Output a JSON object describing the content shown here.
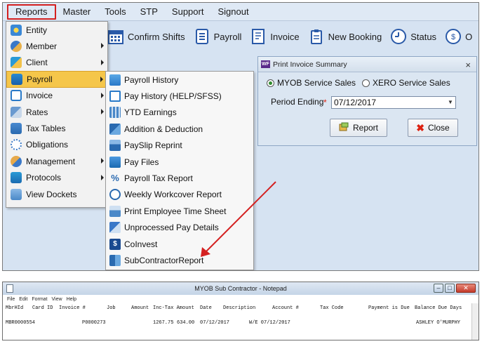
{
  "menubar": {
    "items": [
      "Reports",
      "Master",
      "Tools",
      "STP",
      "Support",
      "Signout"
    ]
  },
  "toolbar": {
    "items": [
      {
        "label": "Confirm Shifts",
        "icon": "calendar-icon"
      },
      {
        "label": "Payroll",
        "icon": "payroll-document-icon"
      },
      {
        "label": "Invoice",
        "icon": "invoice-document-icon"
      },
      {
        "label": "New Booking",
        "icon": "clipboard-icon"
      },
      {
        "label": "Status",
        "icon": "clock-icon"
      },
      {
        "label": "O",
        "icon": "dollar-clock-icon"
      }
    ]
  },
  "reports_menu": {
    "items": [
      {
        "label": "Entity",
        "icon": "entity-icon",
        "submenu": false
      },
      {
        "label": "Member",
        "icon": "member-icon",
        "submenu": true
      },
      {
        "label": "Client",
        "icon": "client-icon",
        "submenu": true
      },
      {
        "label": "Payroll",
        "icon": "payroll-folder-icon",
        "submenu": true
      },
      {
        "label": "Invoice",
        "icon": "invoice-icon",
        "submenu": true
      },
      {
        "label": "Rates",
        "icon": "rates-icon",
        "submenu": true
      },
      {
        "label": "Tax Tables",
        "icon": "tax-tables-icon",
        "submenu": false
      },
      {
        "label": "Obligations",
        "icon": "obligations-icon",
        "submenu": false
      },
      {
        "label": "Management",
        "icon": "management-icon",
        "submenu": true
      },
      {
        "label": "Protocols",
        "icon": "protocols-icon",
        "submenu": true
      },
      {
        "label": "View Dockets",
        "icon": "dockets-icon",
        "submenu": false
      }
    ]
  },
  "payroll_submenu": {
    "items": [
      "Payroll History",
      "Pay History (HELP/SFSS)",
      "YTD Earnings",
      "Addition & Deduction",
      "PaySlip Reprint",
      "Pay Files",
      "Payroll Tax Report",
      "Weekly Workcover Report",
      "Print Employee Time Sheet",
      "Unprocessed Pay Details",
      "CoInvest",
      "SubContractorReport"
    ]
  },
  "dialog": {
    "title": "Print Invoice Summary",
    "logo_text": "WF",
    "close_glyph": "×",
    "radio_myob": "MYOB Service Sales",
    "radio_xero": "XERO Service Sales",
    "selected": "MYOB Service Sales",
    "period_label": "Period Ending",
    "required_mark": "*",
    "period_value": "07/12/2017",
    "report_button": "Report",
    "close_button": "Close"
  },
  "notepad": {
    "title": "MYOB Sub Contractor - Notepad",
    "menu": [
      "File",
      "Edit",
      "Format",
      "View",
      "Help"
    ],
    "headers": [
      "MbrHId",
      "Card ID",
      "Invoice #",
      "Job",
      "Amount",
      "Inc-Tax Amount",
      "Date",
      "Description",
      "Account #",
      "Tax Code",
      "Payment is Due",
      "Balance Due Days"
    ],
    "row": [
      "MBR0000554",
      "P0000273",
      "1267.75",
      "634.00",
      "07/12/2017",
      "W/E 07/12/2017",
      "ASHLEY O'MURPHY"
    ]
  },
  "colors": {
    "highlight": "#f5c64a",
    "annotation_red": "#d42020",
    "menubar_bg": "#dfe9f5"
  }
}
